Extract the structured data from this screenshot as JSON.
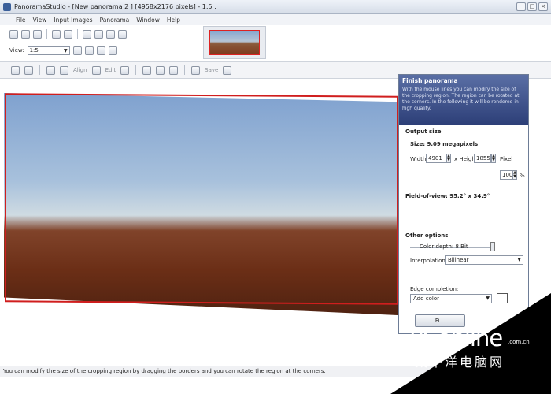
{
  "window": {
    "title": "PanoramaStudio - [New panorama 2 ] [4958x2176 pixels] - 1:5 :",
    "controls": [
      "_",
      "□",
      "×"
    ]
  },
  "menu": [
    "File",
    "View",
    "Input Images",
    "Panorama",
    "Window",
    "Help"
  ],
  "toolbar": {
    "view_label": "View:",
    "view_value": "1:5",
    "align_label": "Align",
    "edit_label": "Edit",
    "save_label": "Save"
  },
  "panel": {
    "title": "Finish panorama",
    "description": "With the mouse lines you can modify the size of the cropping region. The region can be rotated at the corners. In the following it will be rendered in high quality.",
    "output_size_heading": "Output size",
    "size_text": "Size: 9.09 megapixels",
    "width_label": "Width",
    "width_value": "4901",
    "height_label": "x Height",
    "height_value": "1855",
    "pixel_unit": "Pixel",
    "scale_value": "100",
    "scale_unit": "%",
    "scale_level_percent": 100,
    "fov_text": "Field-of-view: 95.2° x 34.9°",
    "other_heading": "Other options",
    "color_depth_text": "Color depth: 8 Bit",
    "interpolation_label": "Interpolation:",
    "interpolation_value": "Bilinear",
    "edge_label": "Edge completion:",
    "edge_value": "Add color",
    "finish_button": "Fi..."
  },
  "statusbar": {
    "text": "You can modify the size of the cropping region by dragging the borders and you can rotate the region at the corners."
  },
  "watermark": {
    "brand": "PConline",
    "domain": ".com.cn",
    "chinese": "太平洋电脑网"
  }
}
